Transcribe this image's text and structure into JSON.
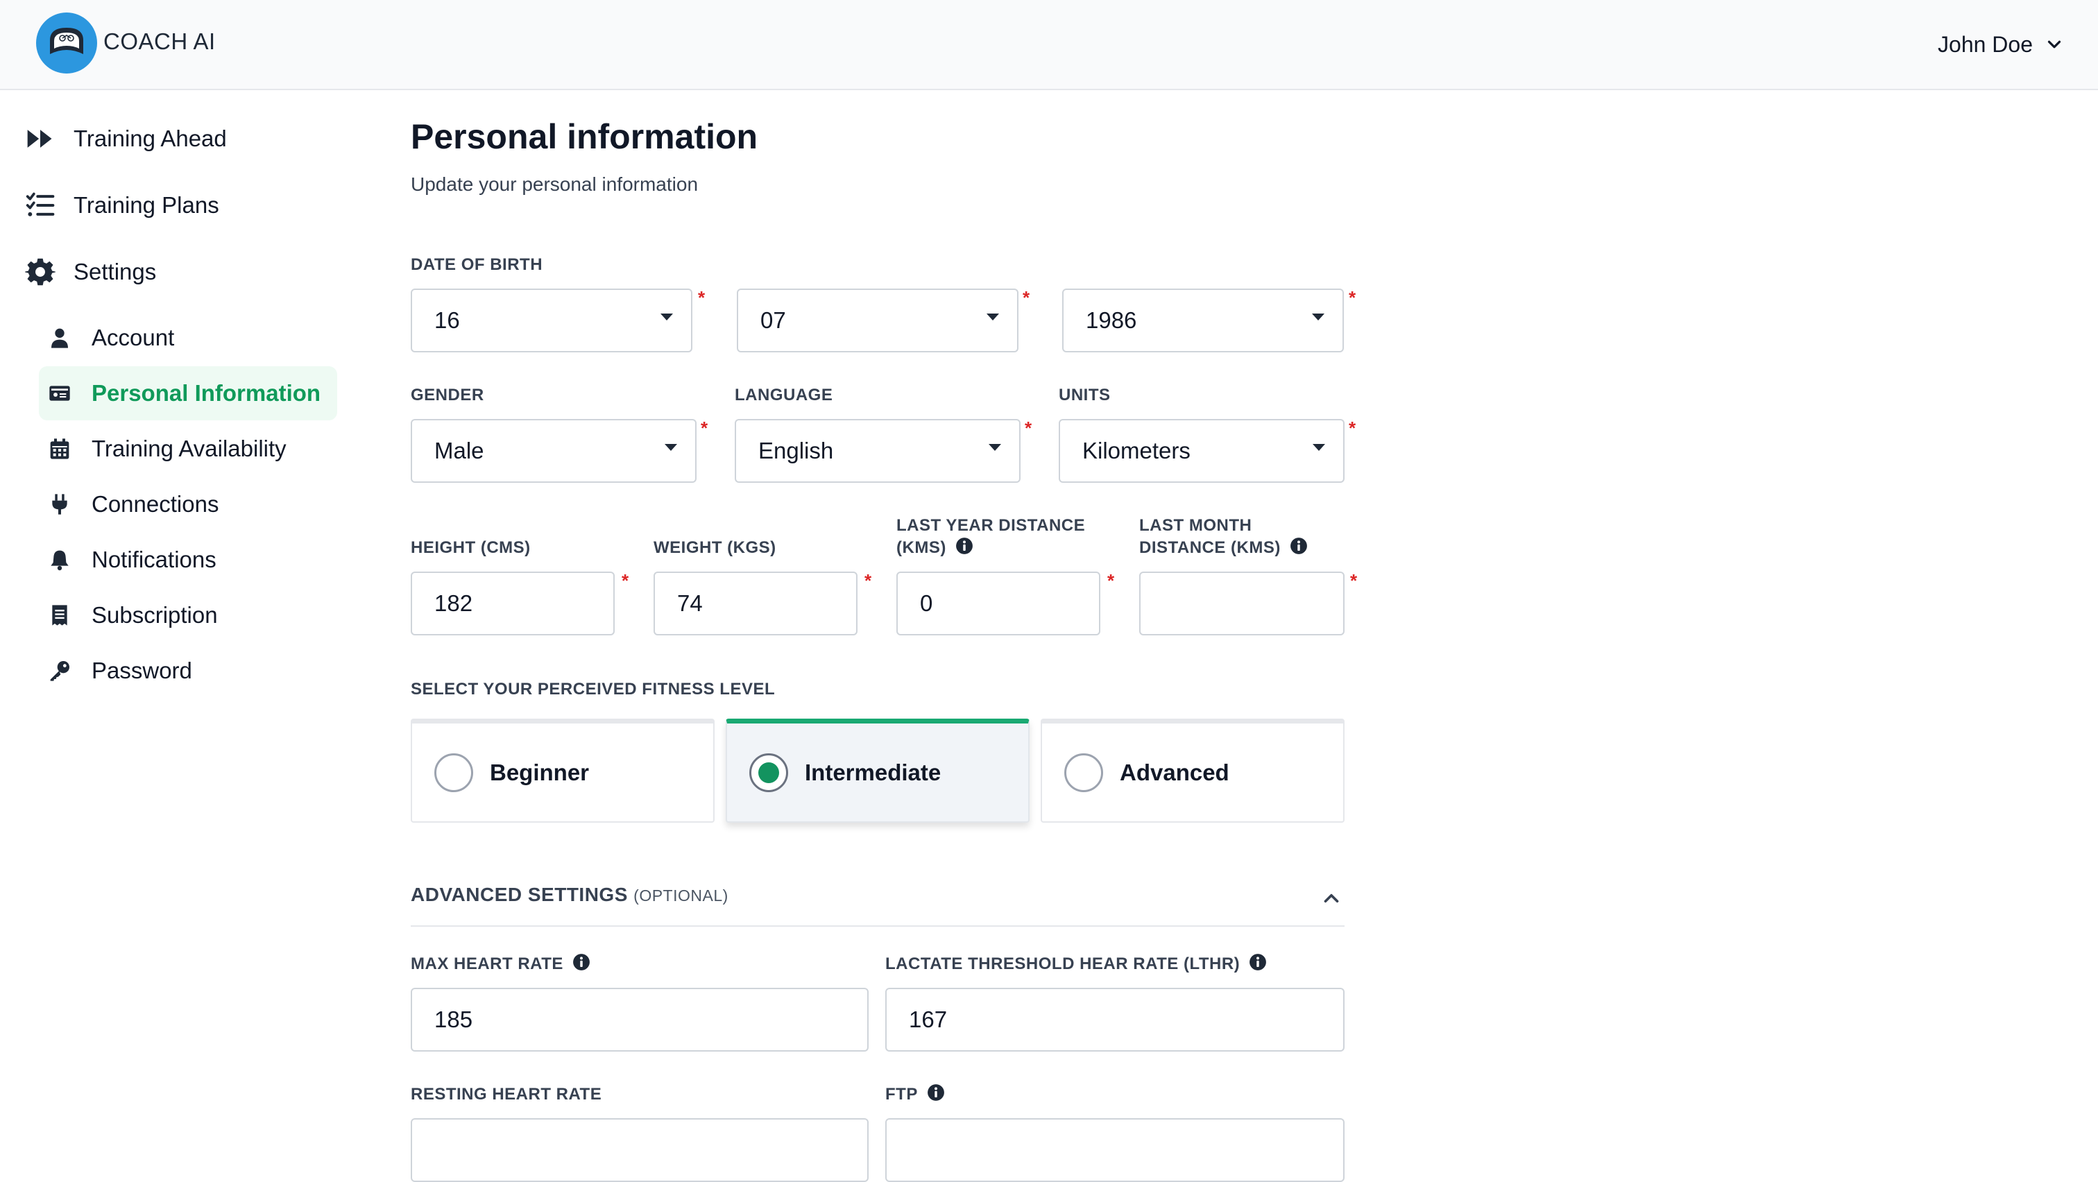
{
  "header": {
    "brand": "COACH AI",
    "user_name": "John Doe"
  },
  "sidebar": {
    "main": [
      {
        "label": "Training Ahead",
        "icon": "fast-forward-icon"
      },
      {
        "label": "Training Plans",
        "icon": "list-check-icon"
      },
      {
        "label": "Settings",
        "icon": "gear-icon"
      }
    ],
    "sub": [
      {
        "label": "Account",
        "icon": "user-icon"
      },
      {
        "label": "Personal Information",
        "icon": "id-card-icon",
        "active": true
      },
      {
        "label": "Training Availability",
        "icon": "calendar-icon"
      },
      {
        "label": "Connections",
        "icon": "plug-icon"
      },
      {
        "label": "Notifications",
        "icon": "bell-icon"
      },
      {
        "label": "Subscription",
        "icon": "receipt-icon"
      },
      {
        "label": "Password",
        "icon": "key-icon"
      }
    ]
  },
  "page": {
    "title": "Personal information",
    "subtitle": "Update your personal information"
  },
  "form": {
    "dob": {
      "label": "DATE OF BIRTH",
      "day": "16",
      "month": "07",
      "year": "1986"
    },
    "gender": {
      "label": "GENDER",
      "value": "Male"
    },
    "language": {
      "label": "LANGUAGE",
      "value": "English"
    },
    "units": {
      "label": "UNITS",
      "value": "Kilometers"
    },
    "height": {
      "label": "HEIGHT (CMS)",
      "value": "182"
    },
    "weight": {
      "label": "WEIGHT (KGS)",
      "value": "74"
    },
    "last_year": {
      "label_line1": "LAST YEAR DISTANCE",
      "label_line2": "(KMS)",
      "value": "0"
    },
    "last_month": {
      "label_line1": "LAST MONTH",
      "label_line2": "DISTANCE (KMS)",
      "value": ""
    },
    "required_mark": "*",
    "fitness": {
      "label": "SELECT YOUR PERCEIVED FITNESS LEVEL",
      "options": [
        "Beginner",
        "Intermediate",
        "Advanced"
      ],
      "selected": "Intermediate"
    },
    "advanced": {
      "title": "ADVANCED SETTINGS",
      "optional": "(OPTIONAL)",
      "expanded": true,
      "max_hr": {
        "label": "MAX HEART RATE",
        "value": "185"
      },
      "lthr": {
        "label": "LACTATE THRESHOLD HEAR RATE (LTHR)",
        "value": "167"
      },
      "resting_hr": {
        "label": "RESTING HEART RATE"
      },
      "ftp": {
        "label": "FTP"
      }
    }
  },
  "colors": {
    "accent_green": "#109a5a",
    "active_bg": "#eefaf3",
    "logo_blue": "#2c97df",
    "required_red": "#dc2626"
  }
}
